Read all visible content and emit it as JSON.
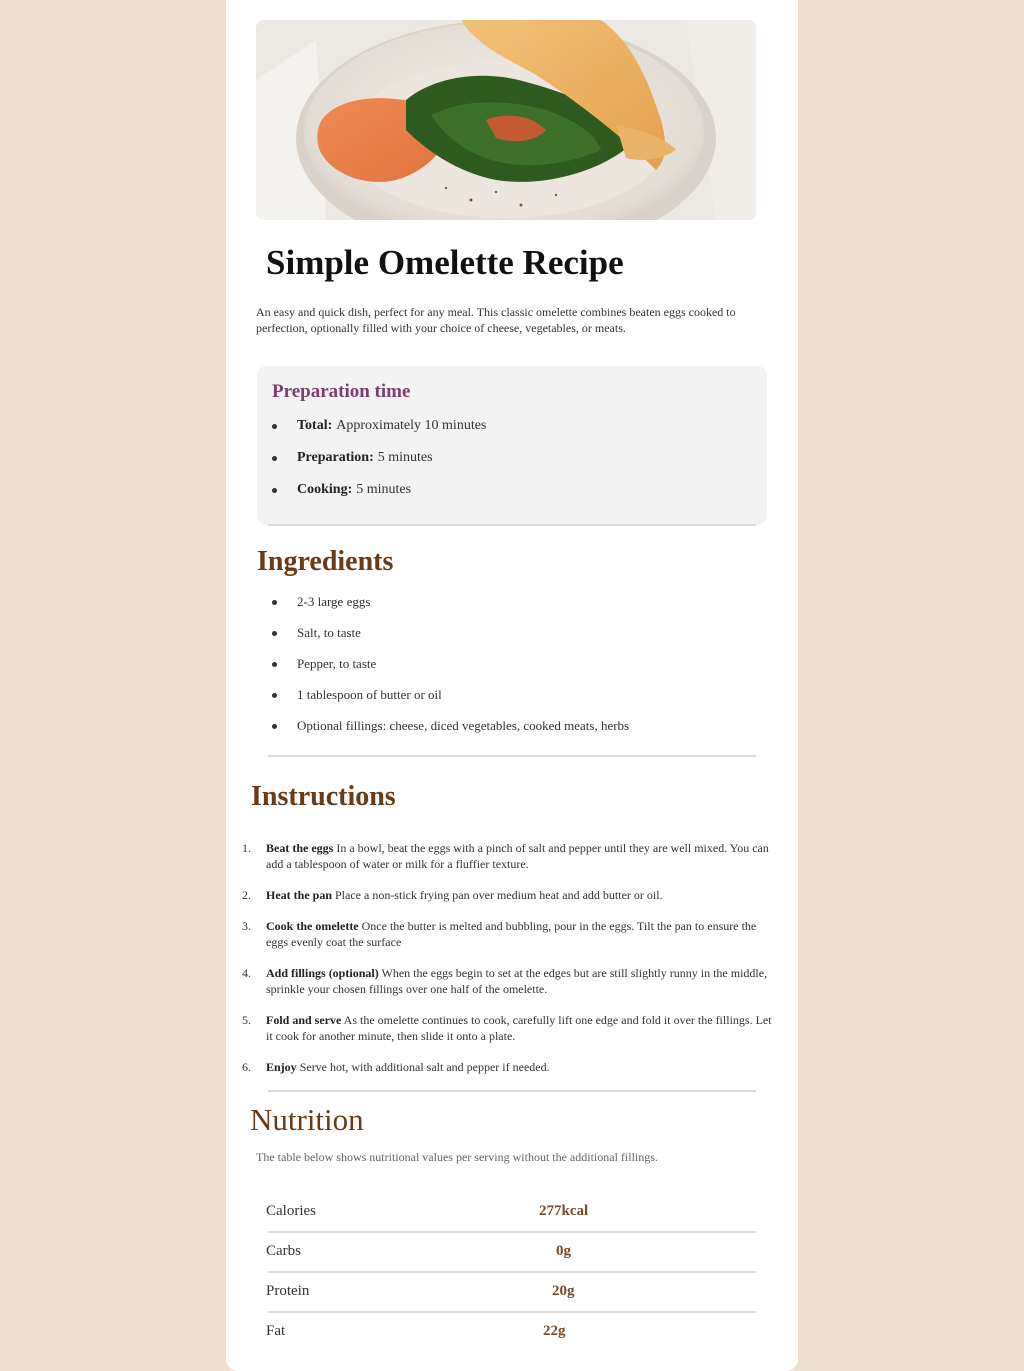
{
  "recipe": {
    "title": "Simple Omelette Recipe",
    "intro": "An easy and quick dish, perfect for any meal. This classic omelette combines beaten eggs cooked to perfection, optionally filled with your choice of cheese, vegetables, or meats."
  },
  "prep": {
    "heading": "Preparation time",
    "items": [
      {
        "label": "Total:",
        "value": "Approximately 10 minutes"
      },
      {
        "label": "Preparation:",
        "value": "5 minutes"
      },
      {
        "label": "Cooking:",
        "value": "5 minutes"
      }
    ]
  },
  "ingredients": {
    "heading": "Ingredients",
    "items": [
      "2-3 large eggs",
      "Salt, to taste",
      "Pepper, to taste",
      "1 tablespoon of butter or oil",
      "Optional fillings: cheese, diced vegetables, cooked meats, herbs"
    ]
  },
  "instructions": {
    "heading": "Instructions",
    "steps": [
      {
        "num": "1.",
        "title": "Beat the eggs",
        "text": " In a bowl, beat the eggs with a pinch of salt and pepper until they are well mixed. You can add a tablespoon of water or milk for a fluffier texture."
      },
      {
        "num": "2.",
        "title": "Heat the pan",
        "text": " Place a non-stick frying pan over medium heat and add butter or oil."
      },
      {
        "num": "3.",
        "title": "Cook the omelette",
        "text": " Once the butter is melted and bubbling, pour in the eggs. Tilt the pan to ensure the eggs evenly coat the surface"
      },
      {
        "num": "4.",
        "title": "Add fillings (optional)",
        "text": " When the eggs begin to set at the edges but are still slightly runny in the middle, sprinkle your chosen fillings over one half of the omelette."
      },
      {
        "num": "5.",
        "title": "Fold and serve",
        "text": " As the omelette continues to cook, carefully lift one edge and fold it over the fillings. Let it cook for another minute, then slide it onto a plate."
      },
      {
        "num": "6.",
        "title": "Enjoy",
        "text": " Serve hot, with additional salt and pepper if needed."
      }
    ]
  },
  "nutrition": {
    "heading": "Nutrition",
    "note": "The table below shows nutritional values per serving without the additional fillings.",
    "rows": [
      {
        "label": "Calories",
        "value": "277kcal"
      },
      {
        "label": "Carbs",
        "value": "0g"
      },
      {
        "label": "Protein",
        "value": "20g"
      },
      {
        "label": "Fat",
        "value": "22g"
      }
    ]
  },
  "colors": {
    "page_bg": "#eedfd0",
    "card_bg": "#ffffff",
    "prep_heading": "#7a3f6c",
    "section_heading": "#6b3a16",
    "nutrition_value": "#7a4a2a"
  }
}
